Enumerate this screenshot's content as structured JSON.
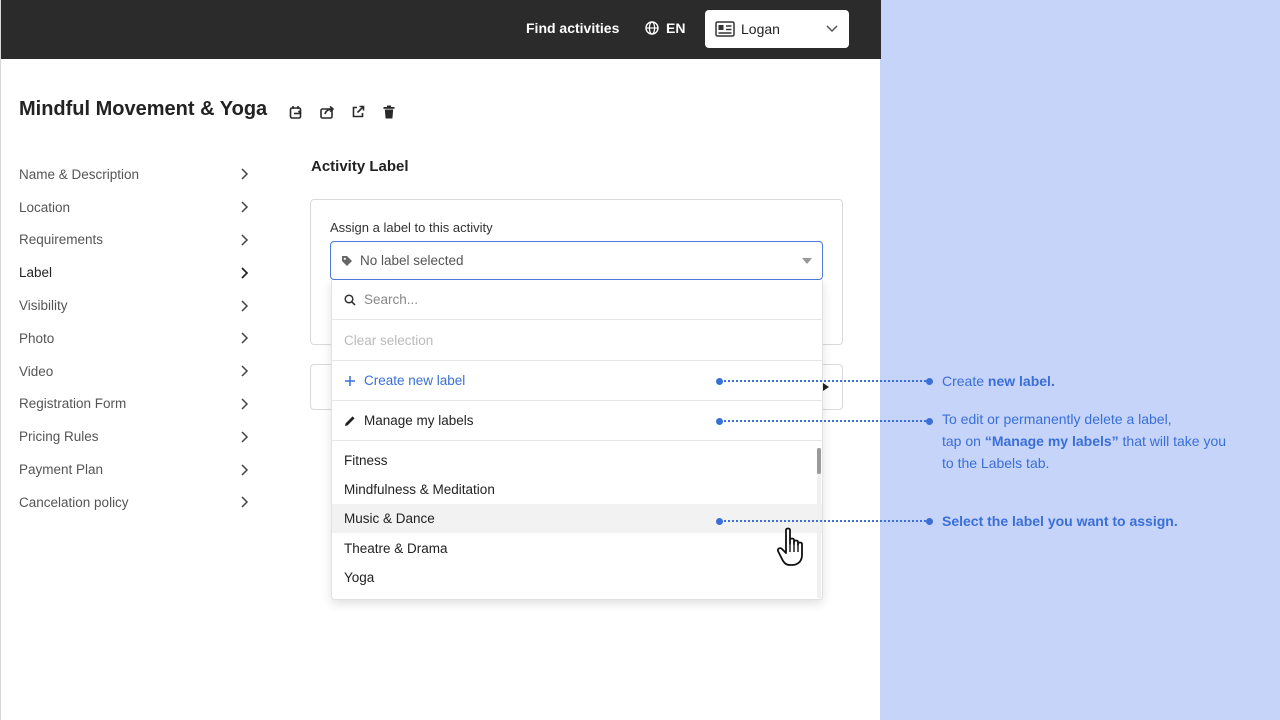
{
  "topbar": {
    "find_activities": "Find activities",
    "language": "EN",
    "user_name": "Logan"
  },
  "page": {
    "title": "Mindful Movement & Yoga"
  },
  "sidebar": {
    "items": [
      {
        "label": "Name & Description"
      },
      {
        "label": "Location"
      },
      {
        "label": "Requirements"
      },
      {
        "label": "Label"
      },
      {
        "label": "Visibility"
      },
      {
        "label": "Photo"
      },
      {
        "label": "Video"
      },
      {
        "label": "Registration Form"
      },
      {
        "label": "Pricing Rules"
      },
      {
        "label": "Payment Plan"
      },
      {
        "label": "Cancelation policy"
      }
    ],
    "active": "Label"
  },
  "main": {
    "section_title": "Activity Label",
    "assign_label": "Assign a label to this activity",
    "select_value": "No label selected"
  },
  "dropdown": {
    "search_placeholder": "Search...",
    "clear_selection": "Clear selection",
    "create_label": "Create new label",
    "manage_label": "Manage my labels",
    "options": [
      "Fitness",
      "Mindfulness & Meditation",
      "Music & Dance",
      "Theatre & Drama",
      "Yoga"
    ],
    "hovered_option": "Music & Dance"
  },
  "annotations": {
    "create_prefix": "Create ",
    "create_bold": "new label.",
    "manage_line1": "To edit or permanently delete a label,",
    "manage_line2_prefix": "tap on ",
    "manage_line2_bold": "“Manage my labels”",
    "manage_line2_suffix": " that will take you",
    "manage_line3": "to the Labels tab.",
    "select_text": "Select the label you want to assign."
  },
  "colors": {
    "accent": "#3a6fd8",
    "topbar": "#2b2b2b",
    "panel_bg": "#c5d4f8"
  }
}
